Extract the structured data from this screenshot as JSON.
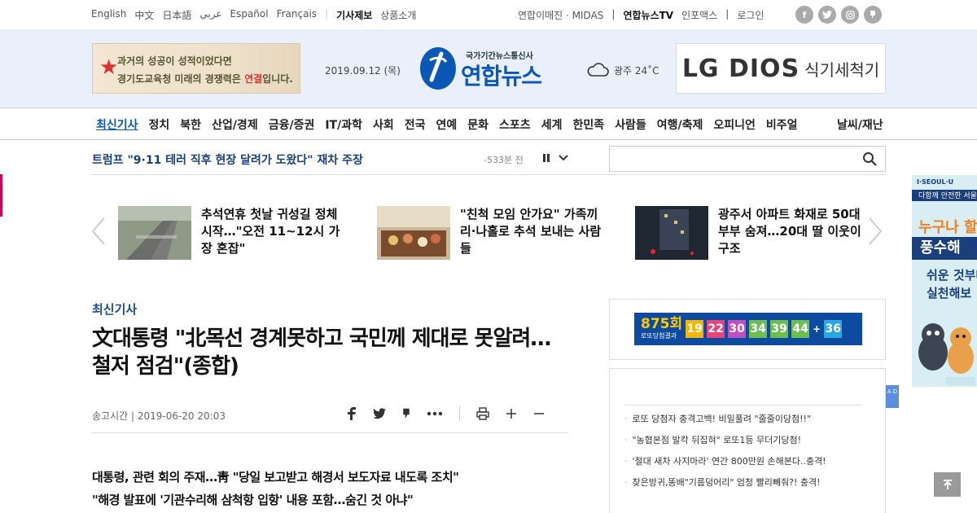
{
  "lang_links": [
    "English",
    "中文",
    "日本語",
    "عربي",
    "Español",
    "Français"
  ],
  "util_links": {
    "report": "기사제보",
    "products": "상품소개",
    "images": "연합이매진 · MIDAS",
    "tv": "연합뉴스TV",
    "infomax": "인포맥스",
    "login": "로그인"
  },
  "social": {
    "facebook": "f",
    "twitter": "t",
    "instagram": "o",
    "story": "j"
  },
  "header": {
    "promo_line1": "과거의 성공이 성적이었다면",
    "promo_line2a": "경기도교육청 미래의 경쟁력은 ",
    "promo_line2b": "연결",
    "promo_line2c": "입니다.",
    "date": "2019.09.12 (목)",
    "logo_sub": "국가기간뉴스통신사",
    "logo_main": "연합뉴스",
    "weather": "광주 24˚C",
    "ad_brand": "LG DIOS",
    "ad_product": "식기세척기"
  },
  "nav": {
    "items": [
      "최신기사",
      "정치",
      "북한",
      "산업/경제",
      "금융/증권",
      "IT/과학",
      "사회",
      "전국",
      "연예",
      "문화",
      "스포츠",
      "세계",
      "한민족",
      "사람들",
      "여행/축제",
      "오피니언",
      "비주얼"
    ],
    "last": "날씨/재난"
  },
  "ticker": {
    "headline": "트럼프 \"9·11 테러 직후 현장 달려가 도왔다\" 재차 주장",
    "time": "-533분 전"
  },
  "search": {
    "placeholder": ""
  },
  "featured": [
    {
      "title": "추석연휴 첫날 귀성길 정체 시작…\"오전 11~12시 가장 혼잡\""
    },
    {
      "title": "\"친척 모임 안가요\" 가족끼리·나홀로 추석 보내는 사람들"
    },
    {
      "title": "광주서 아파트 화재로 50대 부부 숨져…20대 딸 이웃이 구조"
    }
  ],
  "article": {
    "category": "최신기사",
    "headline_line1": "文대통령 \"北목선 경계못하고 국민께 제대로 못알려…",
    "headline_line2": "철저 점검\"(종합)",
    "meta": "송고시간 | 2019-06-20 20:03",
    "summary1": "대통령, 관련 회의 주재…靑 \"당일 보고받고 해경서 보도자료 내도록 조치\"",
    "summary2": "\"해경 발표에 '기관수리해 삼척항 입항' 내용 포함…숨긴 것 아냐\""
  },
  "lotto": {
    "round": "875회",
    "label": "로또당첨결과",
    "numbers": [
      "19",
      "22",
      "30",
      "34",
      "39",
      "44"
    ],
    "plus": "+",
    "bonus": "36"
  },
  "ad_list": [
    "로또 당첨자 충격고백! 비밀풀려 \"줄줄이당첨!!\"",
    "\"농협본점 발칵 뒤집혀\" 로또1등 무더기당첨!",
    "'절대 새차 사지마라' 연간 800만원 손해본다..충격!",
    "찾은방귀,똥배\"기름덩어리\" 엄청 빨리빼줘?! 충격!"
  ],
  "ad_tag": "A D",
  "side_ad": {
    "brand": "I·SEOUL·U",
    "bar": "다함께 안전한 서울",
    "l1": "누구나 할 수",
    "l2": "풍수해",
    "l3": "쉬운 것부터",
    "l4": "실천해보"
  },
  "colors": {
    "brand_blue": "#0b57b5",
    "header_bg": "#e9f0fb",
    "accent_red": "#d2004e"
  }
}
